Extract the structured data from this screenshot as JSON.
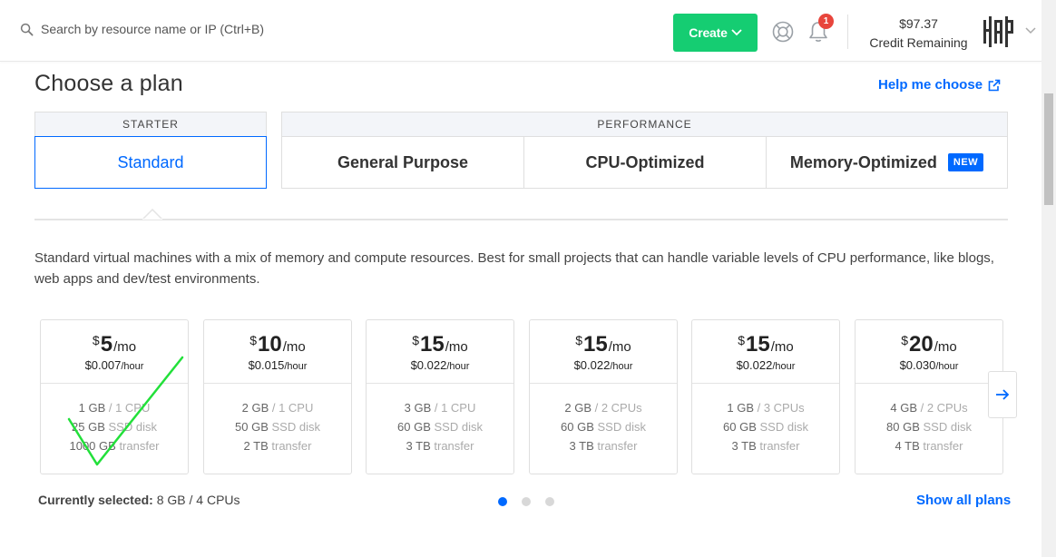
{
  "header": {
    "search_placeholder": "Search by resource name or IP (Ctrl+B)",
    "create_label": "Create",
    "notification_count": "1",
    "credit_amount": "$97.37",
    "credit_label": "Credit Remaining"
  },
  "page": {
    "title": "Choose a plan",
    "help_link": "Help me choose"
  },
  "tabs": {
    "starter_group": "STARTER",
    "performance_group": "PERFORMANCE",
    "items": [
      {
        "label": "Standard",
        "active": true
      },
      {
        "label": "General Purpose"
      },
      {
        "label": "CPU-Optimized"
      },
      {
        "label": "Memory-Optimized",
        "badge": "NEW"
      }
    ]
  },
  "description": "Standard virtual machines with a mix of memory and compute resources. Best for small projects that can handle variable levels of CPU performance, like blogs, web apps and dev/test environments.",
  "plans": [
    {
      "currency": "$",
      "monthly": "5",
      "per": "/mo",
      "hourly": "$0.007",
      "hourly_unit": "/hour",
      "mem": "1 GB",
      "cpu": "1 CPU",
      "disk": "25 GB",
      "disk_unit": "SSD disk",
      "transfer": "1000 GB",
      "transfer_unit": "transfer"
    },
    {
      "currency": "$",
      "monthly": "10",
      "per": "/mo",
      "hourly": "$0.015",
      "hourly_unit": "/hour",
      "mem": "2 GB",
      "cpu": "1 CPU",
      "disk": "50 GB",
      "disk_unit": "SSD disk",
      "transfer": "2 TB",
      "transfer_unit": "transfer"
    },
    {
      "currency": "$",
      "monthly": "15",
      "per": "/mo",
      "hourly": "$0.022",
      "hourly_unit": "/hour",
      "mem": "3 GB",
      "cpu": "1 CPU",
      "disk": "60 GB",
      "disk_unit": "SSD disk",
      "transfer": "3 TB",
      "transfer_unit": "transfer"
    },
    {
      "currency": "$",
      "monthly": "15",
      "per": "/mo",
      "hourly": "$0.022",
      "hourly_unit": "/hour",
      "mem": "2 GB",
      "cpu": "2 CPUs",
      "disk": "60 GB",
      "disk_unit": "SSD disk",
      "transfer": "3 TB",
      "transfer_unit": "transfer"
    },
    {
      "currency": "$",
      "monthly": "15",
      "per": "/mo",
      "hourly": "$0.022",
      "hourly_unit": "/hour",
      "mem": "1 GB",
      "cpu": "3 CPUs",
      "disk": "60 GB",
      "disk_unit": "SSD disk",
      "transfer": "3 TB",
      "transfer_unit": "transfer"
    },
    {
      "currency": "$",
      "monthly": "20",
      "per": "/mo",
      "hourly": "$0.030",
      "hourly_unit": "/hour",
      "mem": "4 GB",
      "cpu": "2 CPUs",
      "disk": "80 GB",
      "disk_unit": "SSD disk",
      "transfer": "4 TB",
      "transfer_unit": "transfer"
    }
  ],
  "footer": {
    "selected_label": "Currently selected:",
    "selected_value": "8 GB / 4 CPUs",
    "show_all": "Show all plans",
    "page_count": 3,
    "active_page": 1
  },
  "colors": {
    "accent": "#0069ff",
    "create": "#15cd72",
    "badge": "#e8453c",
    "annotation_check": "#22e03a"
  },
  "icons": [
    "search-icon",
    "chevron-down-icon",
    "help-lifebuoy-icon",
    "bell-icon",
    "avatar-logo",
    "external-link-icon",
    "arrow-right-icon"
  ]
}
